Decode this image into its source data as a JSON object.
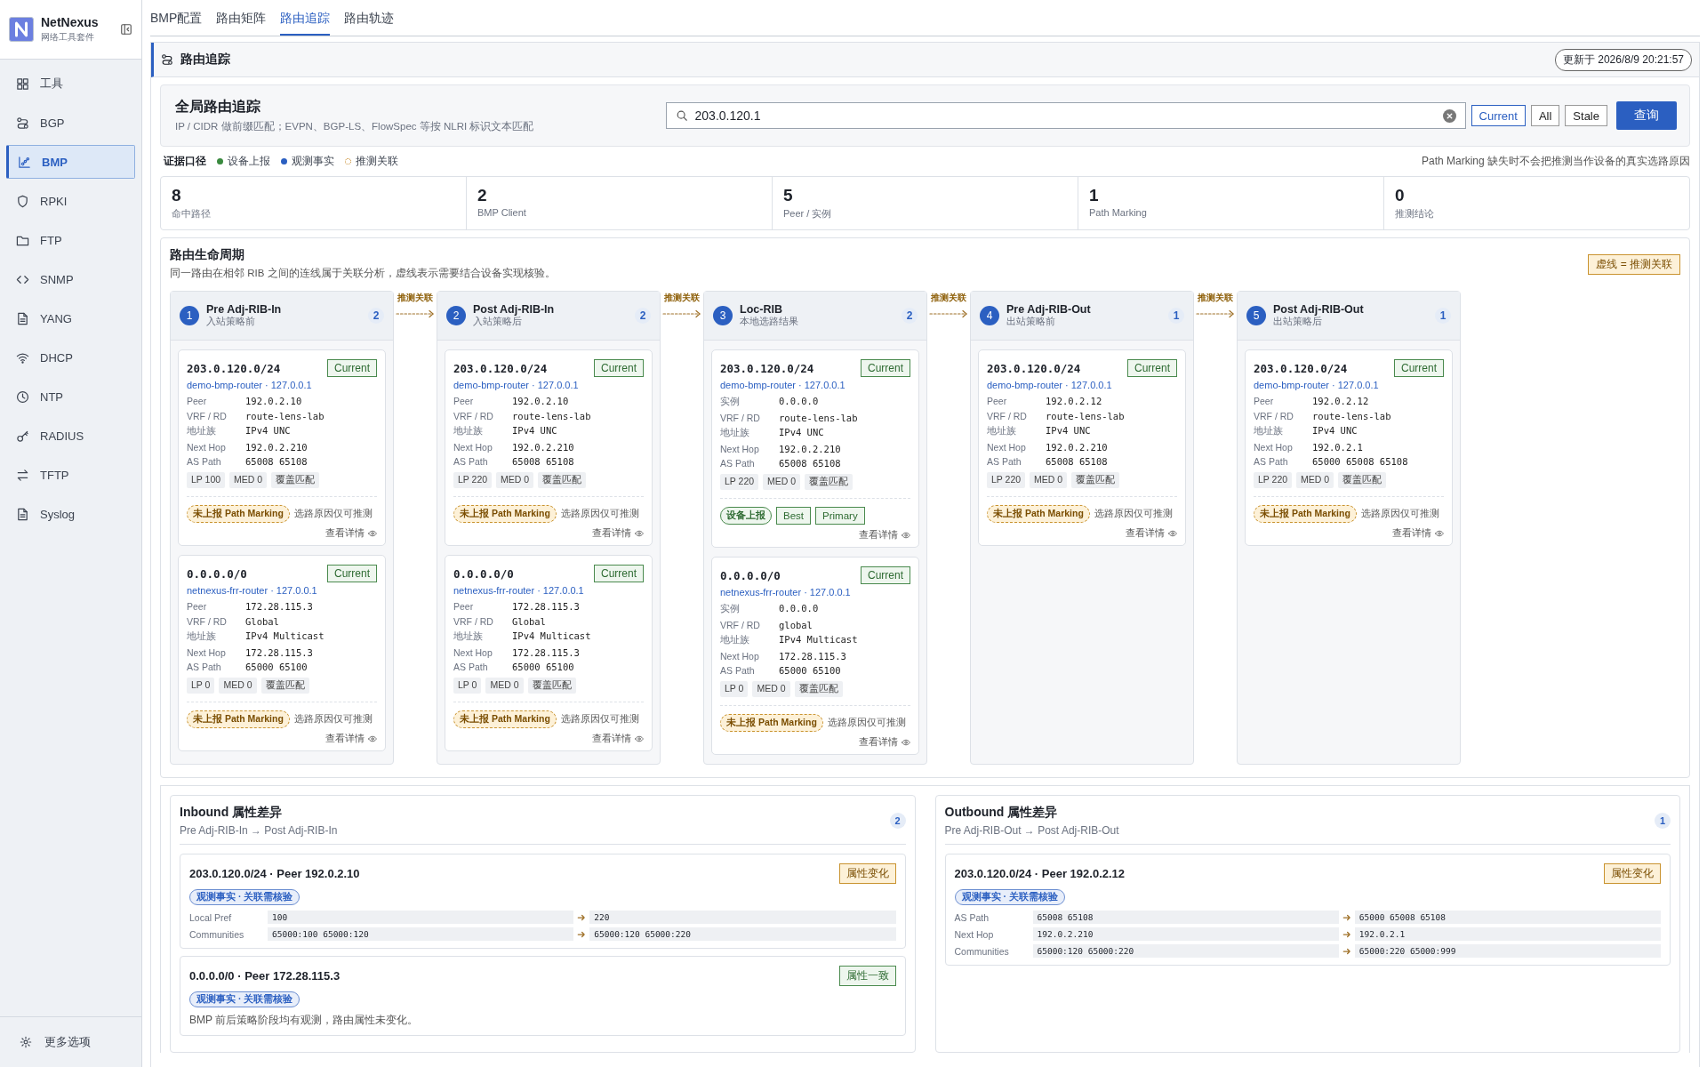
{
  "app": {
    "name": "NetNexus",
    "subtitle": "网络工具套件"
  },
  "sidebar": {
    "items": [
      {
        "label": "工具",
        "selected": false
      },
      {
        "label": "BGP",
        "selected": false
      },
      {
        "label": "BMP",
        "selected": true
      },
      {
        "label": "RPKI",
        "selected": false
      },
      {
        "label": "FTP",
        "selected": false
      },
      {
        "label": "SNMP",
        "selected": false
      },
      {
        "label": "YANG",
        "selected": false
      },
      {
        "label": "DHCP",
        "selected": false
      },
      {
        "label": "NTP",
        "selected": false
      },
      {
        "label": "RADIUS",
        "selected": false
      },
      {
        "label": "TFTP",
        "selected": false
      },
      {
        "label": "Syslog",
        "selected": false
      }
    ],
    "footer": "更多选项"
  },
  "tabs": [
    {
      "label": "BMP配置",
      "selected": false
    },
    {
      "label": "路由矩阵",
      "selected": false
    },
    {
      "label": "路由追踪",
      "selected": true
    },
    {
      "label": "路由轨迹",
      "selected": false
    }
  ],
  "section": {
    "title": "路由追踪",
    "updated": "更新于 2026/8/9 20:21:57"
  },
  "search": {
    "title": "全局路由追踪",
    "hint": "IP / CIDR 做前缀匹配；EVPN、BGP-LS、FlowSpec 等按 NLRI 标识文本匹配",
    "value": "203.0.120.1",
    "filters": [
      {
        "label": "Current",
        "selected": true
      },
      {
        "label": "All",
        "selected": false
      },
      {
        "label": "Stale",
        "selected": false
      }
    ],
    "button": "查询"
  },
  "legend": {
    "title": "证据口径",
    "items": [
      {
        "kind": "reported",
        "label": "设备上报"
      },
      {
        "kind": "observed",
        "label": "观测事实"
      },
      {
        "kind": "inferred",
        "label": "推测关联"
      }
    ],
    "note": "Path Marking 缺失时不会把推测当作设备的真实选路原因"
  },
  "stats": [
    {
      "value": "8",
      "label": "命中路径"
    },
    {
      "value": "2",
      "label": "BMP Client"
    },
    {
      "value": "5",
      "label": "Peer / 实例"
    },
    {
      "value": "1",
      "label": "Path Marking"
    },
    {
      "value": "0",
      "label": "推测结论"
    }
  ],
  "lifecycle": {
    "title": "路由生命周期",
    "subtitle": "同一路由在相邻 RIB 之间的连线属于关联分析，虚线表示需要结合设备实现核验。",
    "legend": "虚线 = 推测关联",
    "links": [
      "推测关联",
      "推测关联",
      "推测关联",
      "推测关联"
    ],
    "stages": [
      {
        "num": "1",
        "title": "Pre Adj-RIB-In",
        "subtitle": "入站策略前",
        "count": "2",
        "routes": [
          {
            "prefix": "203.0.120.0/24",
            "status": "Current",
            "router": "demo-bmp-router · 127.0.0.1",
            "fields": [
              [
                "Peer",
                "192.0.2.10"
              ],
              [
                "VRF / RD",
                "route-lens-lab"
              ],
              [
                "地址族",
                "IPv4 UNC"
              ],
              [
                "Next Hop",
                "192.0.2.210"
              ],
              [
                "AS Path",
                "65008 65108"
              ]
            ],
            "chips": [
              "LP 100",
              "MED 0",
              "覆盖匹配"
            ],
            "evidence": [
              {
                "kind": "inferred",
                "text": "未上报 Path Marking"
              }
            ],
            "note": "选路原因仅可推测",
            "link": "查看详情"
          },
          {
            "prefix": "0.0.0.0/0",
            "status": "Current",
            "router": "netnexus-frr-router · 127.0.0.1",
            "fields": [
              [
                "Peer",
                "172.28.115.3"
              ],
              [
                "VRF / RD",
                "Global"
              ],
              [
                "地址族",
                "IPv4 Multicast"
              ],
              [
                "Next Hop",
                "172.28.115.3"
              ],
              [
                "AS Path",
                "65000 65100"
              ]
            ],
            "chips": [
              "LP 0",
              "MED 0",
              "覆盖匹配"
            ],
            "evidence": [
              {
                "kind": "inferred",
                "text": "未上报 Path Marking"
              }
            ],
            "note": "选路原因仅可推测",
            "link": "查看详情"
          }
        ]
      },
      {
        "num": "2",
        "title": "Post Adj-RIB-In",
        "subtitle": "入站策略后",
        "count": "2",
        "routes": [
          {
            "prefix": "203.0.120.0/24",
            "status": "Current",
            "router": "demo-bmp-router · 127.0.0.1",
            "fields": [
              [
                "Peer",
                "192.0.2.10"
              ],
              [
                "VRF / RD",
                "route-lens-lab"
              ],
              [
                "地址族",
                "IPv4 UNC"
              ],
              [
                "Next Hop",
                "192.0.2.210"
              ],
              [
                "AS Path",
                "65008 65108"
              ]
            ],
            "chips": [
              "LP 220",
              "MED 0",
              "覆盖匹配"
            ],
            "evidence": [
              {
                "kind": "inferred",
                "text": "未上报 Path Marking"
              }
            ],
            "note": "选路原因仅可推测",
            "link": "查看详情"
          },
          {
            "prefix": "0.0.0.0/0",
            "status": "Current",
            "router": "netnexus-frr-router · 127.0.0.1",
            "fields": [
              [
                "Peer",
                "172.28.115.3"
              ],
              [
                "VRF / RD",
                "Global"
              ],
              [
                "地址族",
                "IPv4 Multicast"
              ],
              [
                "Next Hop",
                "172.28.115.3"
              ],
              [
                "AS Path",
                "65000 65100"
              ]
            ],
            "chips": [
              "LP 0",
              "MED 0",
              "覆盖匹配"
            ],
            "evidence": [
              {
                "kind": "inferred",
                "text": "未上报 Path Marking"
              }
            ],
            "note": "选路原因仅可推测",
            "link": "查看详情"
          }
        ]
      },
      {
        "num": "3",
        "title": "Loc-RIB",
        "subtitle": "本地选路结果",
        "count": "2",
        "routes": [
          {
            "prefix": "203.0.120.0/24",
            "status": "Current",
            "router": "demo-bmp-router · 127.0.0.1",
            "fields": [
              [
                "实例",
                "0.0.0.0"
              ],
              [
                "VRF / RD",
                "route-lens-lab"
              ],
              [
                "地址族",
                "IPv4 UNC"
              ],
              [
                "Next Hop",
                "192.0.2.210"
              ],
              [
                "AS Path",
                "65008 65108"
              ]
            ],
            "chips": [
              "LP 220",
              "MED 0",
              "覆盖匹配"
            ],
            "evidence": [
              {
                "kind": "reported",
                "text": "设备上报"
              },
              {
                "kind": "flag",
                "text": "Best"
              },
              {
                "kind": "flag",
                "text": "Primary"
              }
            ],
            "link": "查看详情"
          },
          {
            "prefix": "0.0.0.0/0",
            "status": "Current",
            "router": "netnexus-frr-router · 127.0.0.1",
            "fields": [
              [
                "实例",
                "0.0.0.0"
              ],
              [
                "VRF / RD",
                "global"
              ],
              [
                "地址族",
                "IPv4 Multicast"
              ],
              [
                "Next Hop",
                "172.28.115.3"
              ],
              [
                "AS Path",
                "65000 65100"
              ]
            ],
            "chips": [
              "LP 0",
              "MED 0",
              "覆盖匹配"
            ],
            "evidence": [
              {
                "kind": "inferred",
                "text": "未上报 Path Marking"
              }
            ],
            "note": "选路原因仅可推测",
            "link": "查看详情"
          }
        ]
      },
      {
        "num": "4",
        "title": "Pre Adj-RIB-Out",
        "subtitle": "出站策略前",
        "count": "1",
        "routes": [
          {
            "prefix": "203.0.120.0/24",
            "status": "Current",
            "router": "demo-bmp-router · 127.0.0.1",
            "fields": [
              [
                "Peer",
                "192.0.2.12"
              ],
              [
                "VRF / RD",
                "route-lens-lab"
              ],
              [
                "地址族",
                "IPv4 UNC"
              ],
              [
                "Next Hop",
                "192.0.2.210"
              ],
              [
                "AS Path",
                "65008 65108"
              ]
            ],
            "chips": [
              "LP 220",
              "MED 0",
              "覆盖匹配"
            ],
            "evidence": [
              {
                "kind": "inferred",
                "text": "未上报 Path Marking"
              }
            ],
            "note": "选路原因仅可推测",
            "link": "查看详情"
          }
        ]
      },
      {
        "num": "5",
        "title": "Post Adj-RIB-Out",
        "subtitle": "出站策略后",
        "count": "1",
        "routes": [
          {
            "prefix": "203.0.120.0/24",
            "status": "Current",
            "router": "demo-bmp-router · 127.0.0.1",
            "fields": [
              [
                "Peer",
                "192.0.2.12"
              ],
              [
                "VRF / RD",
                "route-lens-lab"
              ],
              [
                "地址族",
                "IPv4 UNC"
              ],
              [
                "Next Hop",
                "192.0.2.1"
              ],
              [
                "AS Path",
                "65000 65008 65108"
              ]
            ],
            "chips": [
              "LP 220",
              "MED 0",
              "覆盖匹配"
            ],
            "evidence": [
              {
                "kind": "inferred",
                "text": "未上报 Path Marking"
              }
            ],
            "note": "选路原因仅可推测",
            "link": "查看详情"
          }
        ]
      }
    ]
  },
  "diffs": [
    {
      "title": "Inbound 属性差异",
      "subtitle": "Pre Adj-RIB-In → Post Adj-RIB-In",
      "count": "2",
      "items": [
        {
          "title": "203.0.120.0/24 · Peer 192.0.2.10",
          "status": {
            "kind": "changed",
            "text": "属性变化"
          },
          "tag": "观测事实 · 关联需核验",
          "rows": [
            {
              "label": "Local Pref",
              "before": "100",
              "after": "220"
            },
            {
              "label": "Communities",
              "before": "65000:100 65000:120",
              "after": "65000:120 65000:220"
            }
          ]
        },
        {
          "title": "0.0.0.0/0 · Peer 172.28.115.3",
          "status": {
            "kind": "same",
            "text": "属性一致"
          },
          "tag": "观测事实 · 关联需核验",
          "note": "BMP 前后策略阶段均有观测，路由属性未变化。"
        }
      ]
    },
    {
      "title": "Outbound 属性差异",
      "subtitle": "Pre Adj-RIB-Out → Post Adj-RIB-Out",
      "count": "1",
      "items": [
        {
          "title": "203.0.120.0/24 · Peer 192.0.2.12",
          "status": {
            "kind": "changed",
            "text": "属性变化"
          },
          "tag": "观测事实 · 关联需核验",
          "rows": [
            {
              "label": "AS Path",
              "before": "65008 65108",
              "after": "65000 65008 65108"
            },
            {
              "label": "Next Hop",
              "before": "192.0.2.210",
              "after": "192.0.2.1"
            },
            {
              "label": "Communities",
              "before": "65000:120 65000:220",
              "after": "65000:220 65000:999"
            }
          ]
        }
      ]
    }
  ]
}
